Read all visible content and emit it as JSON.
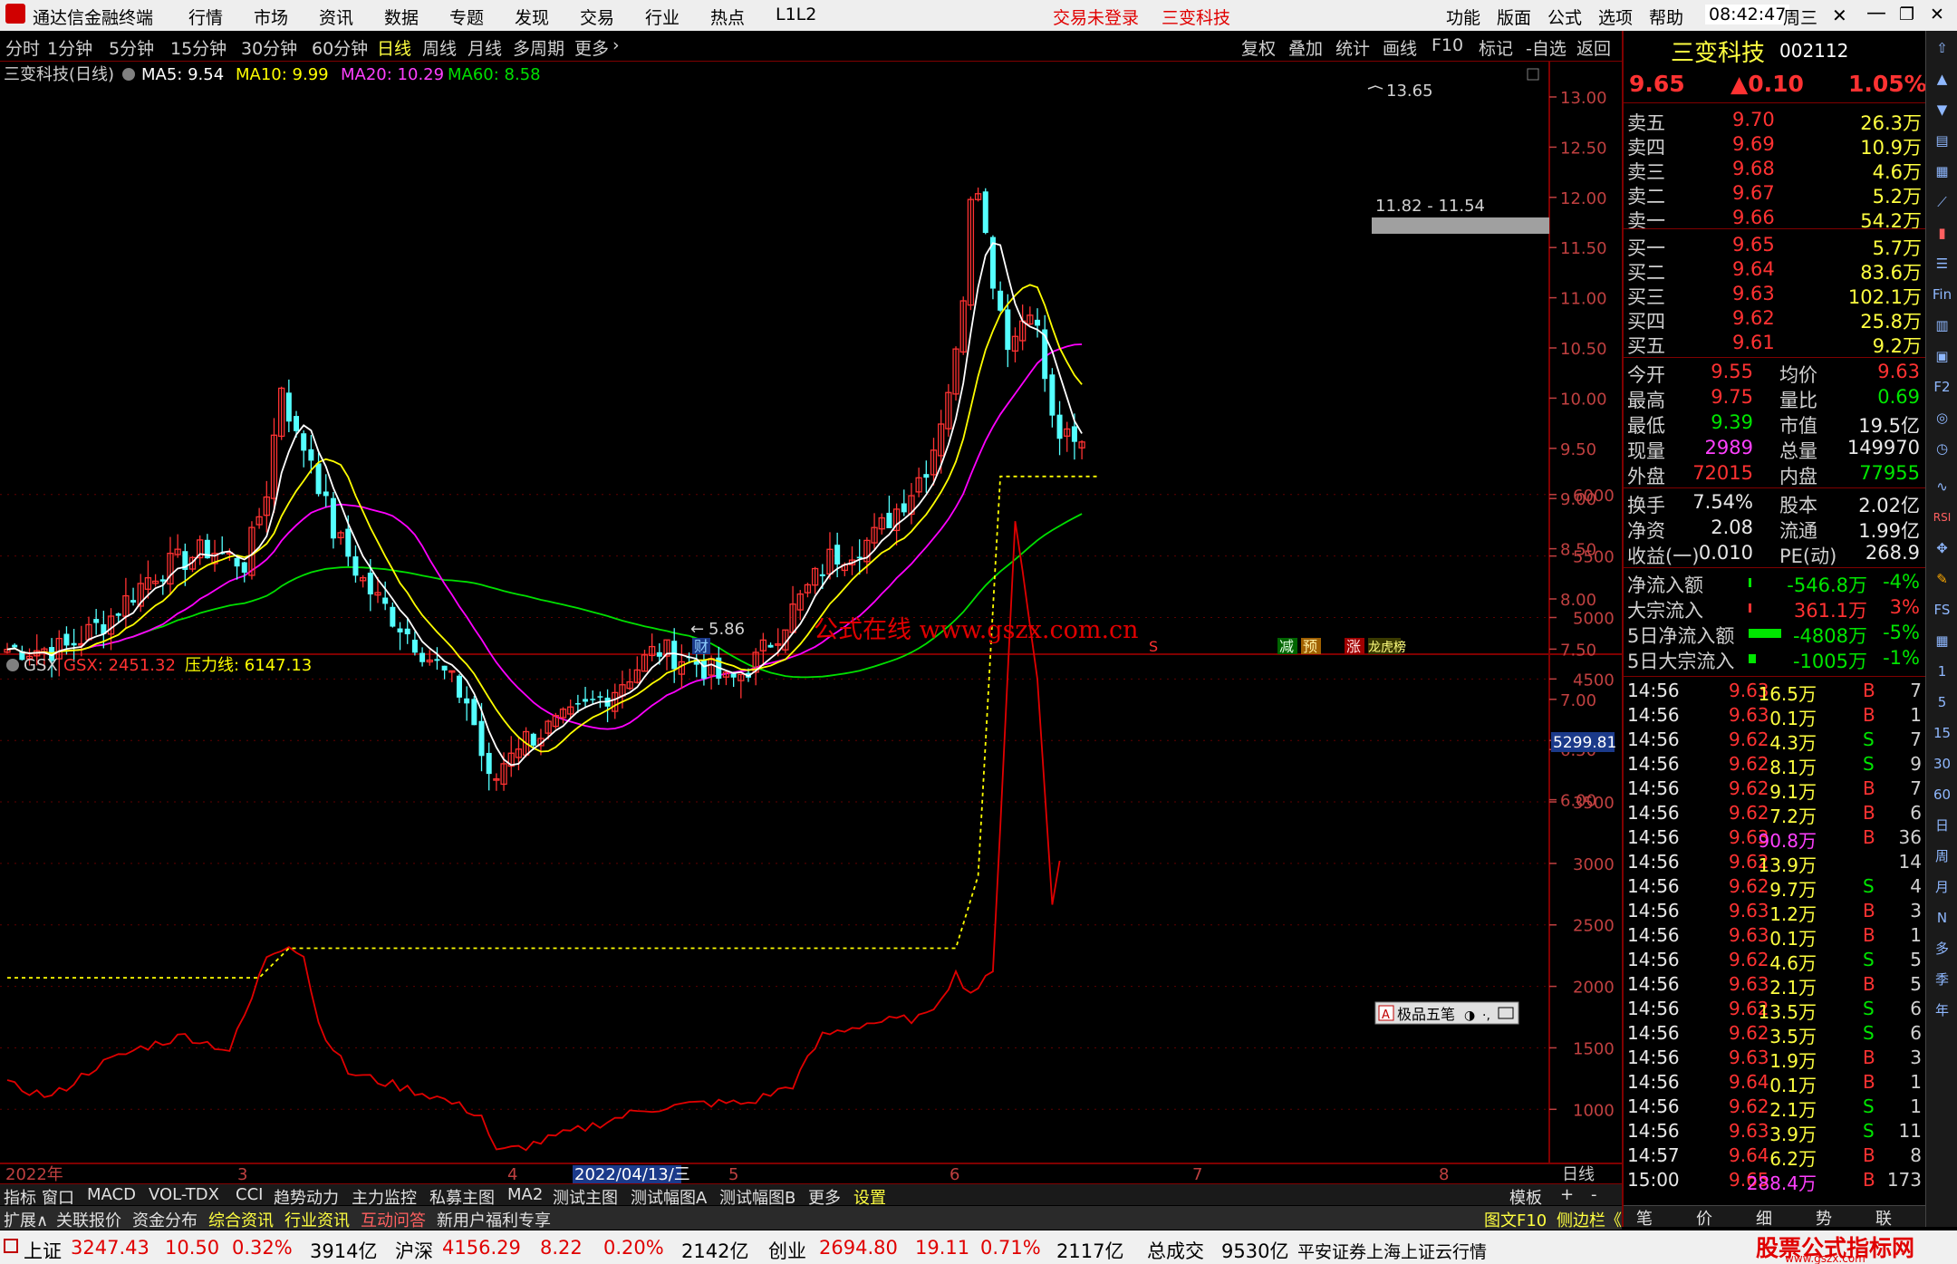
{
  "menubar": {
    "app_title": "通达信金融终端",
    "items": [
      "行情",
      "市场",
      "资讯",
      "数据",
      "专题",
      "发现",
      "交易",
      "行业",
      "热点",
      "L1L2"
    ],
    "trade_status": "交易未登录",
    "stock_name": "三变科技",
    "right_items": [
      "功能",
      "版面",
      "公式",
      "选项",
      "帮助"
    ],
    "clock": "08:42:47",
    "weekday": "周三"
  },
  "periodbar": {
    "periods": [
      "分时",
      "1分钟",
      "5分钟",
      "15分钟",
      "30分钟",
      "60分钟",
      "日线",
      "周线",
      "月线",
      "多周期",
      "更多"
    ],
    "active": "日线",
    "tools": [
      "复权",
      "叠加",
      "统计",
      "画线",
      "F10",
      "标记",
      "-自选",
      "返回"
    ]
  },
  "main_chart": {
    "legend_title": "三变科技(日线)",
    "ma5": "MA5: 9.54",
    "ma10": "MA10: 9.99",
    "ma20": "MA20: 10.29",
    "ma60": "MA60: 8.58",
    "high_label": "13.65",
    "low_label": "5.86",
    "zone_label": "11.82 - 11.54",
    "watermark": "公式在线  www.gszx.com.cn",
    "marks": [
      "财",
      "S",
      "减",
      "预",
      "涨",
      "龙虎榜"
    ],
    "y_ticks": [
      "13.00",
      "12.50",
      "12.00",
      "11.50",
      "11.00",
      "10.50",
      "10.00",
      "9.50",
      "9.00",
      "8.50",
      "8.00",
      "7.50",
      "7.00",
      "6.50",
      "6.00"
    ],
    "colors": {
      "up": "#ff3232",
      "down": "#54ffff",
      "ma5": "#ffffff",
      "ma10": "#ffff00",
      "ma20": "#ff00ff",
      "ma60": "#00e000"
    }
  },
  "sub_chart": {
    "legend_name": "GSX",
    "gsx_value": "GSX: 2451.32",
    "pressure": "压力线: 6147.13",
    "y_ticks": [
      "6000",
      "5500",
      "5000",
      "4500",
      "4000",
      "3500",
      "3000",
      "2500",
      "2000",
      "1500",
      "1000"
    ],
    "cursor_value": "5299.81",
    "popup": "极品五笔"
  },
  "x_axis": {
    "labels": [
      "2022年",
      "3",
      "4",
      "2022/04/13/三",
      "5",
      "6",
      "7",
      "8"
    ],
    "period_label": "日线"
  },
  "quote": {
    "name": "三变科技",
    "code": "002112",
    "price": "9.65",
    "change": "▲0.10",
    "pct": "1.05%",
    "asks": [
      {
        "label": "卖五",
        "price": "9.70",
        "vol": "26.3万"
      },
      {
        "label": "卖四",
        "price": "9.69",
        "vol": "10.9万"
      },
      {
        "label": "卖三",
        "price": "9.68",
        "vol": "4.6万"
      },
      {
        "label": "卖二",
        "price": "9.67",
        "vol": "5.2万"
      },
      {
        "label": "卖一",
        "price": "9.66",
        "vol": "54.2万"
      }
    ],
    "bids": [
      {
        "label": "买一",
        "price": "9.65",
        "vol": "5.7万"
      },
      {
        "label": "买二",
        "price": "9.64",
        "vol": "83.6万"
      },
      {
        "label": "买三",
        "price": "9.63",
        "vol": "102.1万"
      },
      {
        "label": "买四",
        "price": "9.62",
        "vol": "25.8万"
      },
      {
        "label": "买五",
        "price": "9.61",
        "vol": "9.2万"
      }
    ],
    "stats": [
      {
        "l1": "今开",
        "v1": "9.55",
        "l2": "均价",
        "v2": "9.63"
      },
      {
        "l1": "最高",
        "v1": "9.75",
        "l2": "量比",
        "v2": "0.69"
      },
      {
        "l1": "最低",
        "v1": "9.39",
        "l2": "市值",
        "v2": "19.5亿"
      },
      {
        "l1": "现量",
        "v1": "2989",
        "l2": "总量",
        "v2": "149970"
      },
      {
        "l1": "外盘",
        "v1": "72015",
        "l2": "内盘",
        "v2": "77955"
      }
    ],
    "stats2": [
      {
        "l1": "换手",
        "v1": "7.54%",
        "l2": "股本",
        "v2": "2.02亿"
      },
      {
        "l1": "净资",
        "v1": "2.08",
        "l2": "流通",
        "v2": "1.99亿"
      },
      {
        "l1": "收益(一)",
        "v1": "0.010",
        "l2": "PE(动)",
        "v2": "268.9"
      }
    ],
    "flows": [
      {
        "label": "净流入额",
        "value": "-546.8万",
        "pct": "-4%"
      },
      {
        "label": "大宗流入",
        "value": "361.1万",
        "pct": "3%"
      },
      {
        "label": "5日净流入额",
        "value": "-4808万",
        "pct": "-5%"
      },
      {
        "label": "5日大宗流入",
        "value": "-1005万",
        "pct": "-1%"
      }
    ],
    "ticks": [
      {
        "t": "14:56",
        "p": "9.63",
        "v": "16.5万",
        "bs": "B",
        "n": "7"
      },
      {
        "t": "14:56",
        "p": "9.63",
        "v": "0.1万",
        "bs": "B",
        "n": "1"
      },
      {
        "t": "14:56",
        "p": "9.62",
        "v": "4.3万",
        "bs": "S",
        "n": "7"
      },
      {
        "t": "14:56",
        "p": "9.62",
        "v": "8.1万",
        "bs": "S",
        "n": "9"
      },
      {
        "t": "14:56",
        "p": "9.62",
        "v": "9.1万",
        "bs": "B",
        "n": "7"
      },
      {
        "t": "14:56",
        "p": "9.62",
        "v": "7.2万",
        "bs": "B",
        "n": "6"
      },
      {
        "t": "14:56",
        "p": "9.63",
        "v": "90.8万",
        "bs": "B",
        "n": "36"
      },
      {
        "t": "14:56",
        "p": "9.62",
        "v": "13.9万",
        "bs": "",
        "n": "14"
      },
      {
        "t": "14:56",
        "p": "9.62",
        "v": "9.7万",
        "bs": "S",
        "n": "4"
      },
      {
        "t": "14:56",
        "p": "9.63",
        "v": "1.2万",
        "bs": "B",
        "n": "3"
      },
      {
        "t": "14:56",
        "p": "9.63",
        "v": "0.1万",
        "bs": "B",
        "n": "1"
      },
      {
        "t": "14:56",
        "p": "9.62",
        "v": "4.6万",
        "bs": "S",
        "n": "5"
      },
      {
        "t": "14:56",
        "p": "9.63",
        "v": "2.1万",
        "bs": "B",
        "n": "5"
      },
      {
        "t": "14:56",
        "p": "9.62",
        "v": "13.5万",
        "bs": "S",
        "n": "6"
      },
      {
        "t": "14:56",
        "p": "9.62",
        "v": "3.5万",
        "bs": "S",
        "n": "6"
      },
      {
        "t": "14:56",
        "p": "9.63",
        "v": "1.9万",
        "bs": "B",
        "n": "3"
      },
      {
        "t": "14:56",
        "p": "9.64",
        "v": "0.1万",
        "bs": "B",
        "n": "1"
      },
      {
        "t": "14:56",
        "p": "9.62",
        "v": "2.1万",
        "bs": "S",
        "n": "1"
      },
      {
        "t": "14:56",
        "p": "9.63",
        "v": "3.9万",
        "bs": "S",
        "n": "11"
      },
      {
        "t": "14:57",
        "p": "9.64",
        "v": "6.2万",
        "bs": "B",
        "n": "8"
      },
      {
        "t": "15:00",
        "p": "9.65",
        "v": "288.4万",
        "bs": "B",
        "n": "173"
      }
    ],
    "bottom_tabs": [
      "笔",
      "价",
      "细",
      "势",
      "联"
    ]
  },
  "tabs1": [
    "指标",
    "窗口",
    "MACD",
    "VOL-TDX",
    "CCI",
    "趋势动力",
    "主力监控",
    "私募主图",
    "MA2",
    "测试主图",
    "测试幅图A",
    "测试幅图B",
    "更多",
    "设置"
  ],
  "tabs1_right": [
    "模板",
    "+",
    "-"
  ],
  "tabs2": [
    "扩展∧",
    "关联报价",
    "资金分布",
    "综合资讯",
    "行业资讯",
    "互动问答",
    "新用户福利专享"
  ],
  "tabs2_right": [
    "图文F10",
    "侧边栏《"
  ],
  "statusbar": {
    "sh_label": "上证",
    "sh_val": "3247.43",
    "sh_chg": "10.50",
    "sh_pct": "0.32%",
    "sh_amt": "3914亿",
    "hs_label": "沪深",
    "hs_val": "4156.29",
    "hs_chg": "8.22",
    "hs_pct": "0.20%",
    "hs_amt": "2142亿",
    "cy_label": "创业",
    "cy_val": "2694.80",
    "cy_chg": "19.11",
    "cy_pct": "0.71%",
    "cy_amt": "2117亿",
    "total_label": "总成交",
    "total_val": "9530亿",
    "broker": "平安证券上海上证云行情",
    "brand": "股票公式指标网",
    "brand_url": "www.gszx.com"
  }
}
